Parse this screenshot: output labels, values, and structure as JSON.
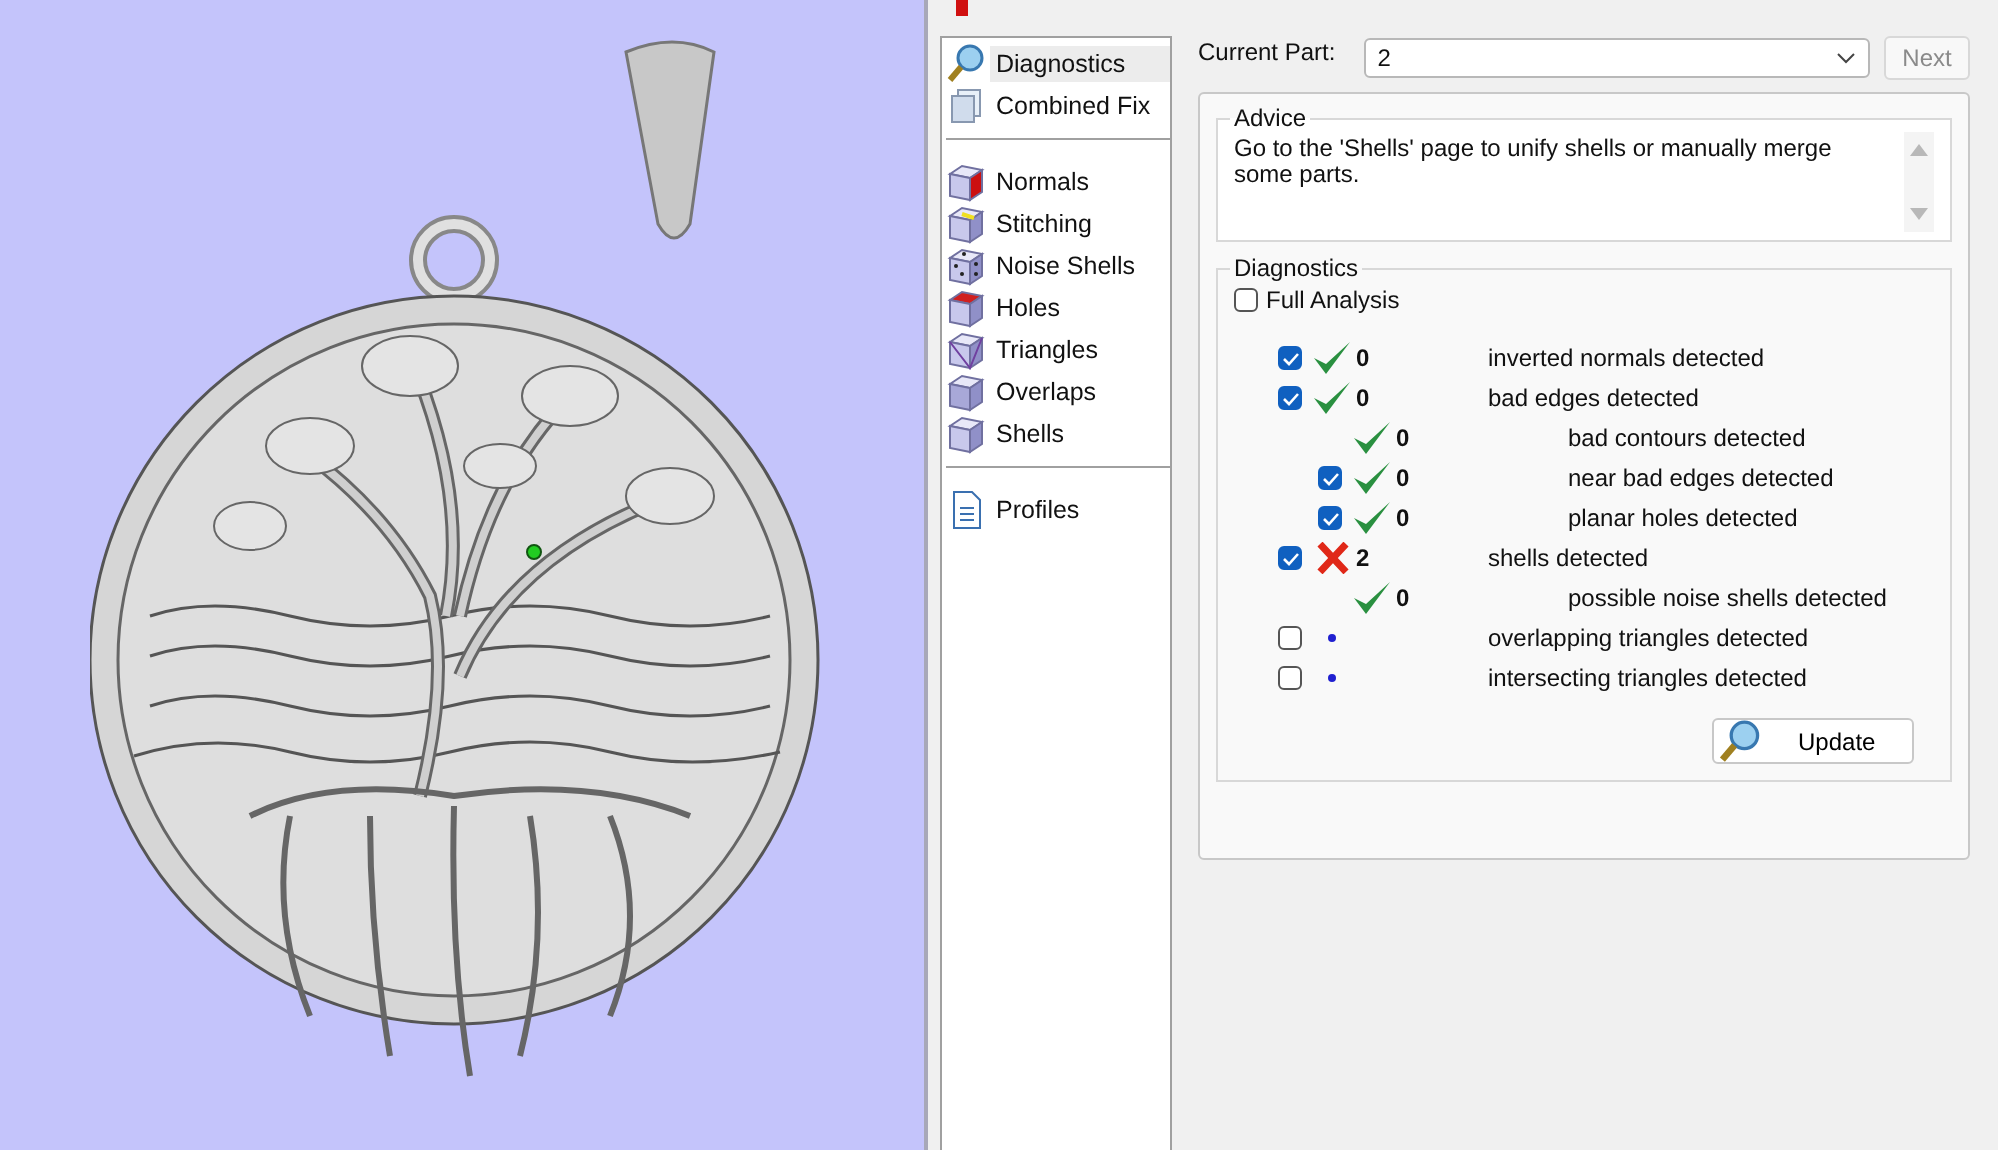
{
  "sidebar": {
    "groups": [
      [
        {
          "label": "Diagnostics",
          "kind": "magnifier",
          "selected": true
        },
        {
          "label": "Combined Fix",
          "kind": "layers",
          "selected": false
        }
      ],
      [
        {
          "label": "Normals",
          "kind": "cube-red-side",
          "selected": false
        },
        {
          "label": "Stitching",
          "kind": "cube-yellow-edge",
          "selected": false
        },
        {
          "label": "Noise Shells",
          "kind": "cube-dotted",
          "selected": false
        },
        {
          "label": "Holes",
          "kind": "cube-red-top",
          "selected": false
        },
        {
          "label": "Triangles",
          "kind": "cube-wire",
          "selected": false
        },
        {
          "label": "Overlaps",
          "kind": "cube-split",
          "selected": false
        },
        {
          "label": "Shells",
          "kind": "cube",
          "selected": false
        }
      ],
      [
        {
          "label": "Profiles",
          "kind": "document",
          "selected": false
        }
      ]
    ]
  },
  "current_part": {
    "label": "Current Part:",
    "value": "2"
  },
  "next_button": {
    "label": "Next",
    "disabled": true
  },
  "advice": {
    "title": "Advice",
    "text": "Go to the 'Shells' page to unify shells or manually merge some parts."
  },
  "diagnostics": {
    "title": "Diagnostics",
    "full_analysis": {
      "label": "Full Analysis",
      "checked": false
    },
    "rows": [
      {
        "checked": true,
        "kind": "ok",
        "count": "0",
        "label": "inverted normals detected"
      },
      {
        "checked": true,
        "kind": "ok",
        "count": "0",
        "label": "bad edges detected",
        "children": [
          {
            "kind": "ok",
            "count": "0",
            "label": "bad contours detected"
          },
          {
            "checked": true,
            "kind": "ok",
            "count": "0",
            "label": "near bad edges detected"
          },
          {
            "checked": true,
            "kind": "ok",
            "count": "0",
            "label": "planar holes detected"
          }
        ]
      },
      {
        "checked": true,
        "kind": "error",
        "count": "2",
        "label": "shells detected",
        "children": [
          {
            "kind": "ok",
            "count": "0",
            "label": "possible noise shells detected"
          }
        ]
      },
      {
        "checked": false,
        "kind": "pending",
        "label": "overlapping triangles detected"
      },
      {
        "checked": false,
        "kind": "pending",
        "label": "intersecting triangles detected"
      }
    ],
    "update_button": {
      "label": "Update"
    }
  }
}
